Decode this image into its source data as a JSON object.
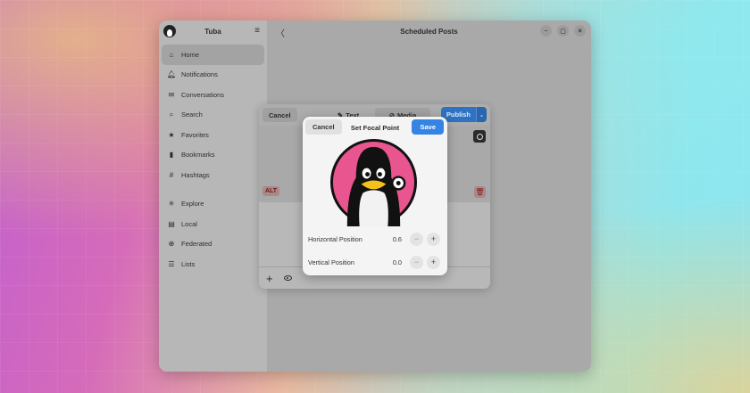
{
  "app": {
    "name": "Tuba",
    "menu_icon": "hamburger-icon"
  },
  "sidebar": {
    "items": [
      {
        "label": "Home",
        "icon": "home-icon",
        "glyph": "⌂",
        "active": true
      },
      {
        "label": "Notifications",
        "icon": "bell-icon",
        "glyph": "🔔︎"
      },
      {
        "label": "Conversations",
        "icon": "mail-icon",
        "glyph": "✉"
      },
      {
        "label": "Search",
        "icon": "search-icon",
        "glyph": "⌕"
      },
      {
        "label": "Favorites",
        "icon": "star-icon",
        "glyph": "★"
      },
      {
        "label": "Bookmarks",
        "icon": "bookmark-icon",
        "glyph": "▮"
      },
      {
        "label": "Hashtags",
        "icon": "hash-icon",
        "glyph": "#"
      }
    ],
    "items2": [
      {
        "label": "Explore",
        "icon": "explore-icon",
        "glyph": "✳"
      },
      {
        "label": "Local",
        "icon": "local-icon",
        "glyph": "▤"
      },
      {
        "label": "Federated",
        "icon": "globe-icon",
        "glyph": "⊕"
      },
      {
        "label": "Lists",
        "icon": "list-icon",
        "glyph": "☰"
      }
    ]
  },
  "main": {
    "title": "Scheduled Posts",
    "back_glyph": "〈",
    "window_buttons": [
      "–",
      "▢",
      "✕"
    ]
  },
  "composer": {
    "cancel_label": "Cancel",
    "tabs": [
      {
        "label": "Text",
        "glyph": "✎"
      },
      {
        "label": "Media",
        "glyph": "⊘"
      }
    ],
    "publish_label": "Publish",
    "publish_arrow": "⌄",
    "alt_label": "ALT",
    "trash_glyph": "🗑︎",
    "add_glyph": "+"
  },
  "focal_dialog": {
    "cancel_label": "Cancel",
    "title": "Set Focal Point",
    "save_label": "Save",
    "rows": [
      {
        "label": "Horizontal Position",
        "value": "0.6"
      },
      {
        "label": "Vertical Position",
        "value": "0.0"
      }
    ],
    "minus_glyph": "−",
    "plus_glyph": "+",
    "focal_point": {
      "x": 0.6,
      "y": 0.0
    }
  },
  "colors": {
    "accent": "#3584e4",
    "alt_text": "#7a1616",
    "avatar_pink": "#e9558f"
  }
}
